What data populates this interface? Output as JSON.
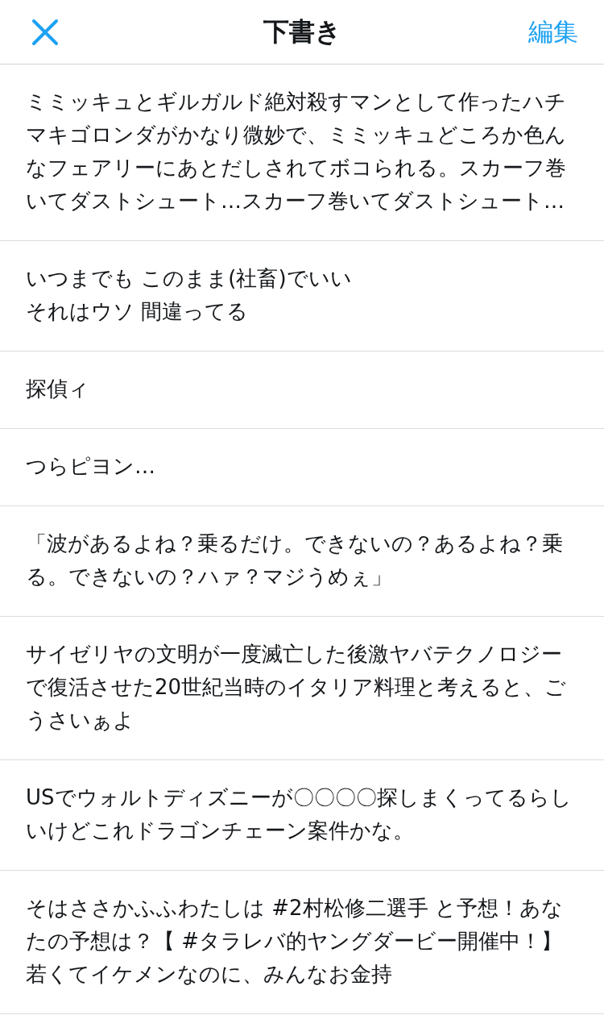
{
  "header": {
    "title": "下書き",
    "edit": "編集"
  },
  "drafts": [
    {
      "lines": [
        "ミミッキュとギルガルド絶対殺すマンとして作ったハチマキゴロンダがかなり微妙で、ミミッキュどころか色んなフェアリーにあとだしされてボコられる。スカーフ巻いてダストシュート…スカーフ巻いてダストシュート…"
      ]
    },
    {
      "lines": [
        "いつまでも このまま(社畜)でいい",
        "それはウソ 間違ってる"
      ]
    },
    {
      "lines": [
        "探偵ィ"
      ]
    },
    {
      "lines": [
        "つらピヨン…"
      ]
    },
    {
      "lines": [
        "「波があるよね？乗るだけ。できないの？あるよね？乗る。できないの？ハァ？マジうめぇ」"
      ]
    },
    {
      "lines": [
        "サイゼリヤの文明が一度滅亡した後激ヤバテクノロジーで復活させた20世紀当時のイタリア料理と考えると、ごうさいぁよ"
      ]
    },
    {
      "lines": [
        "USでウォルトディズニーが〇〇〇〇探しまくってるらしいけどこれドラゴンチェーン案件かな。"
      ]
    },
    {
      "lines": [
        "そはささかふふわたしは #2村松修二選手 と予想！あなたの予想は？【 #タラレバ的ヤングダービー開催中！】若くてイケメンなのに、みんなお金持"
      ]
    }
  ]
}
